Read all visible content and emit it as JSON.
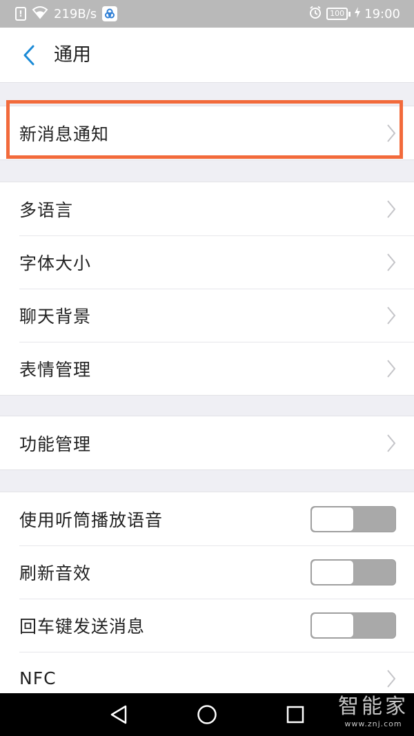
{
  "status_bar": {
    "network_speed": "219B/s",
    "battery": "100",
    "time": "19:00",
    "warning_glyph": "!",
    "icons": [
      "sim-alert-icon",
      "wifi-icon",
      "app-notification-icon",
      "alarm-icon",
      "battery-icon",
      "charging-icon"
    ]
  },
  "header": {
    "title": "通用",
    "back_icon": "chevron-left-icon"
  },
  "sections": {
    "notifications": [
      {
        "label": "新消息通知"
      }
    ],
    "display": [
      {
        "label": "多语言"
      },
      {
        "label": "字体大小"
      },
      {
        "label": "聊天背景"
      },
      {
        "label": "表情管理"
      }
    ],
    "features": [
      {
        "label": "功能管理"
      }
    ],
    "toggles": [
      {
        "label": "使用听筒播放语音",
        "on": false
      },
      {
        "label": "刷新音效",
        "on": false
      },
      {
        "label": "回车键发送消息",
        "on": false
      }
    ],
    "more": [
      {
        "label": "NFC"
      }
    ]
  },
  "nav_bar": {
    "buttons": [
      "back-triangle-icon",
      "home-circle-icon",
      "recents-square-icon"
    ]
  },
  "watermark": {
    "main": "智能家",
    "sub": "www.znj.com"
  },
  "colors": {
    "accent_blue": "#1a8ad6",
    "highlight": "#f26a3b",
    "status_bar_bg": "#b9b9b9",
    "toggle_off": "#a9a9a9",
    "page_bg": "#efeff4"
  }
}
